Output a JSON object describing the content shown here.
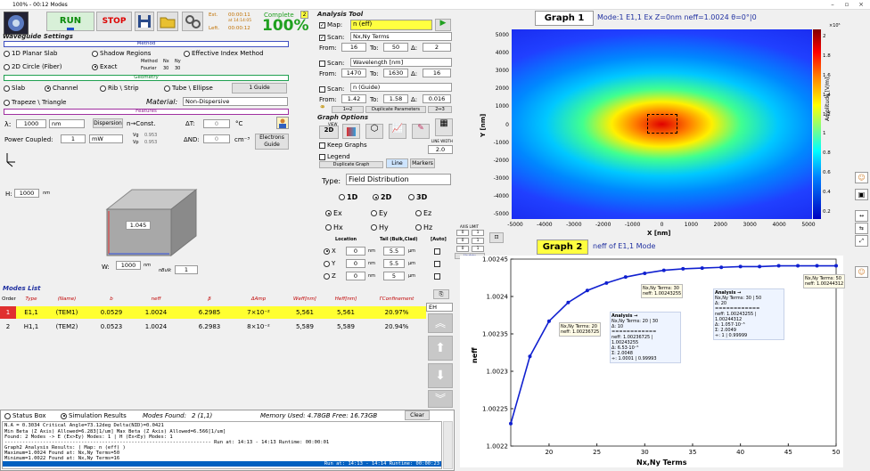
{
  "window": {
    "title": "100% - 00:12 Modes"
  },
  "toolbar": {
    "run": "RUN",
    "stop": "STOP",
    "est_label": "Est.",
    "est_time": "00:00:11",
    "est_at": "at 14:14:05",
    "left_label": "Left.",
    "left_time": "00:00:12",
    "complete_label": "Complete",
    "complete_value": "100%",
    "complete_badge": "2"
  },
  "waveguide": {
    "title": "Waveguide Settings",
    "method_head": "Method",
    "m1": "1D Planar Slab",
    "m2": "Shadow Regions",
    "m3": "Effective Index Method",
    "m4": "2D Circle (Fiber)",
    "m5": "Exact",
    "method_col": "Method",
    "nx_col": "Nx",
    "ny_col": "Ny",
    "fourier": "Fourier",
    "nx_val": "30",
    "ny_val": "30",
    "geometry_head": "Geometry",
    "g1": "Slab",
    "g2": "Channel",
    "g3": "Rib \\ Strip",
    "g4": "Tube \\ Ellipse",
    "guide_btn": "1 Guide",
    "g5": "Trapeze \\ Triangle",
    "material_label": "Material:",
    "material_value": "Non-Dispersive",
    "features_head": "Features",
    "lambda_label": "λ:",
    "lambda_value": "1000",
    "lambda_unit": "nm",
    "dispersion_btn": "Dispersion",
    "n_const": "n→Const.",
    "dT_label": "ΔT:",
    "dT_value": "0",
    "dT_unit": "°C",
    "power_label": "Power Coupled:",
    "power_value": "1",
    "power_unit": "mW",
    "vg_label": "Vg",
    "vg_val": "0.953",
    "vp_label": "Vp",
    "vp_val": "0.953",
    "dN_label": "ΔND:",
    "dN_value": "0",
    "dN_unit": "cm⁻³",
    "electrons_btn": "Electrons",
    "guide_small": "Guide",
    "h_label": "H:",
    "h_value": "1000",
    "h_unit": "nm",
    "n_core": "1.045",
    "w_label": "W:",
    "w_value": "1000",
    "w_unit": "nm",
    "n_bulk_label": "nBulk",
    "n_bulk_value": "1"
  },
  "analysis": {
    "title": "Analysis Tool",
    "map_label": "Map:",
    "map_value": "n (eff)",
    "scan1_label": "Scan:",
    "scan1_value": "Nx,Ny Terms",
    "from1": "16",
    "to1": "50",
    "d1": "2",
    "from_label": "From:",
    "to_label": "To:",
    "delta_label": "Δ:",
    "scan2_label": "Scan:",
    "scan2_value": "Wavelength [nm]",
    "from2": "1470",
    "to2": "1630",
    "d2": "16",
    "scan3_label": "Scan:",
    "scan3_value": "n (Guide)",
    "from3": "1.42",
    "to3": "1.58",
    "d3": "0.016",
    "dup_params": "Duplicate Parameters",
    "a12": "1↔2",
    "a23": "2↔3"
  },
  "graph_options": {
    "title": "Graph Options",
    "view": "VIEW",
    "view2d": "2D",
    "keep_graphs": "Keep Graphs",
    "legend": "Legend",
    "dup_graph": "Duplicate Graph",
    "line_btn": "Line",
    "markers_btn": "Markers",
    "line_width_label": "LINE WIDTH",
    "line_width_value": "2.0",
    "type_label": "Type:",
    "type_value": "Field Distribution",
    "d1": "1D",
    "d2": "2D",
    "d3": "3D",
    "ex": "Ex",
    "ey": "Ey",
    "ez": "Ez",
    "hx": "Hx",
    "hy": "Hy",
    "hz": "Hz",
    "location": "Location",
    "tail": "Tail (Bulk,Clad)",
    "auto": "[Auto]",
    "x_label": "X",
    "y_label": "Y",
    "z_label": "Z",
    "x_val": "0",
    "y_val": "0",
    "z_val": "0",
    "unit_nm": "nm",
    "unit_um": "µm",
    "tx": "5.5",
    "ty": "5.5",
    "tz": "5",
    "axis_limit": "AXIS LIMIT",
    "update_colorbar": "Update Colorbar",
    "al1": "0",
    "al2": "1",
    "al3": "0",
    "al4": "1",
    "al5": "0",
    "al6": "1"
  },
  "modes": {
    "title": "Modes List",
    "headers": [
      "Order",
      "Type",
      "(Name)",
      "b",
      "neff",
      "β",
      "ΔAmp",
      "Weff[nm]",
      "Heff[nm]",
      "ΓConfinement"
    ],
    "rows": [
      {
        "order": "1",
        "type": "E1,1",
        "name": "(TEM1)",
        "b": "0.0529",
        "neff": "1.0024",
        "beta": "6.2985",
        "damp": "7×10⁻²",
        "weff": "5,561",
        "heff": "5,561",
        "gamma": "20.97%"
      },
      {
        "order": "2",
        "type": "H1,1",
        "name": "(TEM2)",
        "b": "0.0523",
        "neff": "1.0024",
        "beta": "6.2983",
        "damp": "8×10⁻²",
        "weff": "5,589",
        "heff": "5,589",
        "gamma": "20.94%"
      }
    ],
    "eh": "EH"
  },
  "status": {
    "tab1": "Status Box",
    "tab2": "Simulation Results",
    "modes_found_label": "Modes Found:",
    "modes_found_value": "2 (1,1)",
    "memory": "Memory Used: 4.78GB  Free: 16.73GB",
    "clear_btn": "Clear",
    "lines": [
      "N.A = 0.3034     Critical Angle=73.12deg     Delta(NID)=0.0421",
      "Min Beta (Z Axis) Allowed=6.283[1/um]    Max Beta (Z Axis) Allowed=6.566[1/um]",
      "Found: 2 Modes -> E (Ex>Ey) Modes: 1  |  H (Ex<Ey) Modes: 1",
      "---------------------------------------------------------------------- Run at: 14:13 - 14:13   Runtime: 00:00:01",
      "Graph2 Analysis Results: ( Map: n (eff) )",
      "Maximum=1.0024  Found at: Nx,Ny Terms=50",
      "Minimum=1.0022  Found at: Nx,Ny Terms=16"
    ],
    "last_line": "Run at: 14:13 - 14:14   Runtime: 00:00:23"
  },
  "graph1": {
    "title": "Graph 1",
    "subtitle": "Mode:1  E1,1  Ex  Z=0nm  neff=1.0024  θ=0°|0",
    "xlabel": "X [nm]",
    "ylabel": "Y [nm]",
    "cbar_label": "Amplitude [V/m]",
    "cbar_exp": "×10⁵",
    "xticks": [
      "-5000",
      "-4000",
      "-3000",
      "-2000",
      "-1000",
      "0",
      "1000",
      "2000",
      "3000",
      "4000",
      "5000"
    ],
    "yticks": [
      "5000",
      "4000",
      "3000",
      "2000",
      "1000",
      "0",
      "-1000",
      "-2000",
      "-3000",
      "-4000",
      "-5000"
    ],
    "cticks": [
      "2",
      "1.8",
      "1.6",
      "1.4",
      "1.2",
      "1",
      "0.8",
      "0.6",
      "0.4",
      "0.2"
    ]
  },
  "graph2": {
    "title": "Graph 2",
    "subtitle": "neff of E1,1 Mode"
  },
  "chart_data": {
    "type": "line",
    "title": "Graph 2",
    "xlabel": "Nx,Ny Terms",
    "ylabel": "neff",
    "x": [
      16,
      18,
      20,
      22,
      24,
      26,
      28,
      30,
      32,
      34,
      36,
      38,
      40,
      42,
      44,
      46,
      48,
      50
    ],
    "y": [
      1.00223,
      1.00232,
      1.002367,
      1.002392,
      1.002408,
      1.002418,
      1.002426,
      1.002431,
      1.002435,
      1.002437,
      1.002438,
      1.002439,
      1.00244,
      1.00244,
      1.002441,
      1.002441,
      1.002441,
      1.002441
    ],
    "xlim": [
      16,
      50
    ],
    "ylim": [
      1.0022,
      1.00245
    ],
    "xticks": [
      "20",
      "25",
      "30",
      "35",
      "40",
      "45",
      "50"
    ],
    "yticks": [
      "1.00245",
      "1.0024",
      "1.00235",
      "1.0023",
      "1.00225",
      "1.0022"
    ],
    "grid": false,
    "annotations": [
      {
        "l1": "Nx,Ny Terms: 20",
        "l2": "neff: 1.00236725"
      },
      {
        "l1": "Nx,Ny Terms: 30",
        "l2": "neff: 1.00243255"
      },
      {
        "l1": "Nx,Ny Terms: 50",
        "l2": "neff: 1.00244312"
      }
    ],
    "analysis_box1": [
      "Analysis →",
      "Nx,Ny Terms: 20 | 30",
      "Δ: 10",
      "============",
      "neff: 1.00236725 | 1.00243255",
      "Δ: 6.53·10⁻⁵",
      "Σ: 2.0048",
      "÷: 1.0001 | 0.99993"
    ],
    "analysis_box2": [
      "Analysis →",
      "Nx,Ny Terms: 30 | 50",
      "Δ: 20",
      "============",
      "neff: 1.00243255 | 1.00244312",
      "Δ: 1.057·10⁻⁵",
      "Σ: 2.0049",
      "÷: 1 | 0.99999"
    ]
  }
}
